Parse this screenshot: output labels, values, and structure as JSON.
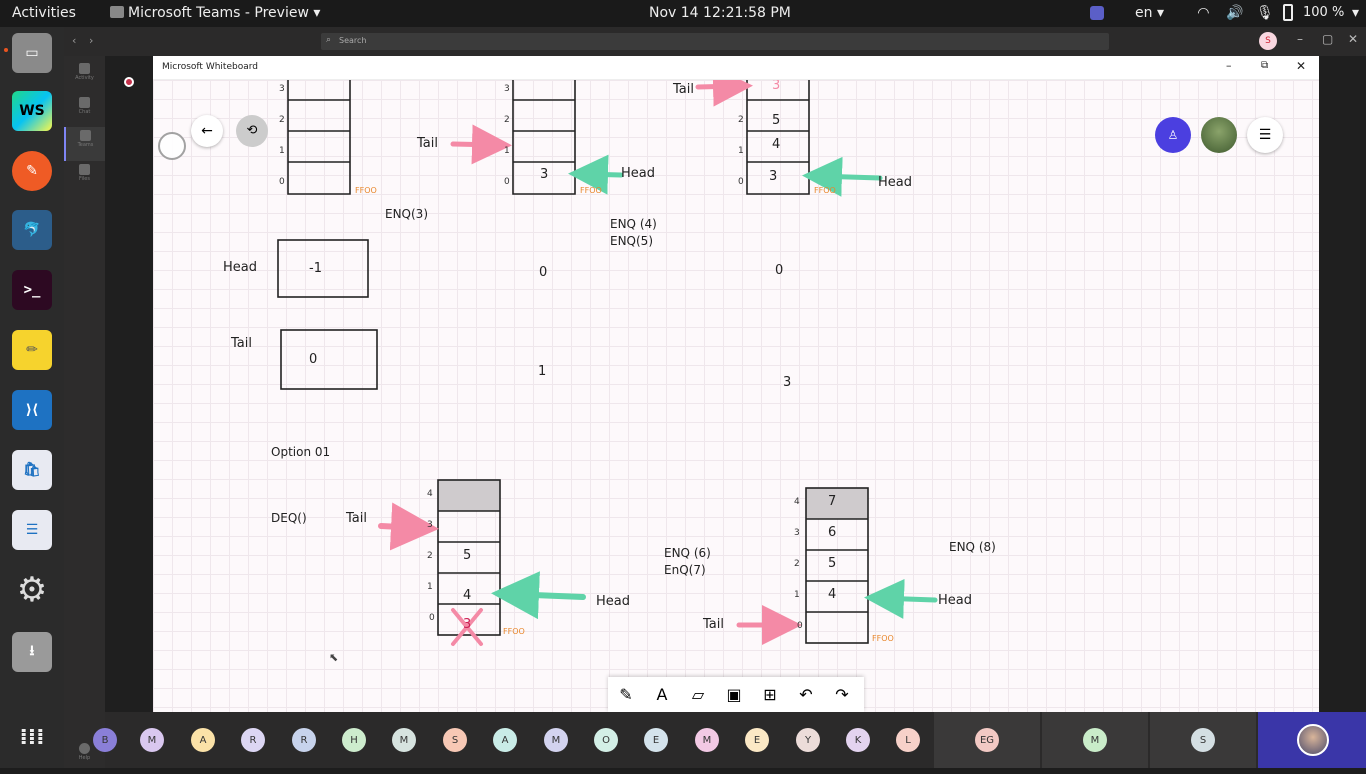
{
  "topbar": {
    "activities": "Activities",
    "app_name": "Microsoft Teams - Preview",
    "datetime": "Nov 14  12:21:58 PM",
    "language": "en",
    "battery": "100 %"
  },
  "teams": {
    "search_placeholder": "Search",
    "rail": [
      "Activity",
      "Chat",
      "Teams",
      "Files"
    ],
    "help": "Help",
    "user_initial": "S"
  },
  "whiteboard": {
    "title": "Microsoft Whiteboard",
    "labels": {
      "enq3": "ENQ(3)",
      "enq45_a": "ENQ (4)",
      "enq45_b": "ENQ(5)",
      "head": "Head",
      "tail": "Tail",
      "head_val": "-1",
      "tail_val": "0",
      "zero_a": "0",
      "zero_b": "0",
      "one": "1",
      "three": "3",
      "option": "Option 01",
      "deq": "DEQ()",
      "enq67_a": "ENQ (6)",
      "enq67_b": "EnQ(7)",
      "enq8": "ENQ (8)",
      "ffoo": "FFOO"
    },
    "q2_values": [
      "3"
    ],
    "q3_values": [
      "3",
      "4",
      "5",
      "3"
    ],
    "q4_values": [
      "5",
      "4",
      "3"
    ],
    "q5_values": [
      "7",
      "6",
      "5",
      "4"
    ],
    "indices": [
      "4",
      "3",
      "2",
      "1",
      "0"
    ]
  },
  "participants": [
    "B",
    "M",
    "A",
    "R",
    "R",
    "H",
    "M",
    "S",
    "A",
    "M",
    "O",
    "E",
    "M",
    "E",
    "Y",
    "K",
    "L",
    "EG",
    "M",
    "S"
  ],
  "colors": {
    "pink": "#f48aa6",
    "green": "#5fd3a8",
    "teams_purple": "#4b3fe0",
    "orange": "#e8872c"
  }
}
